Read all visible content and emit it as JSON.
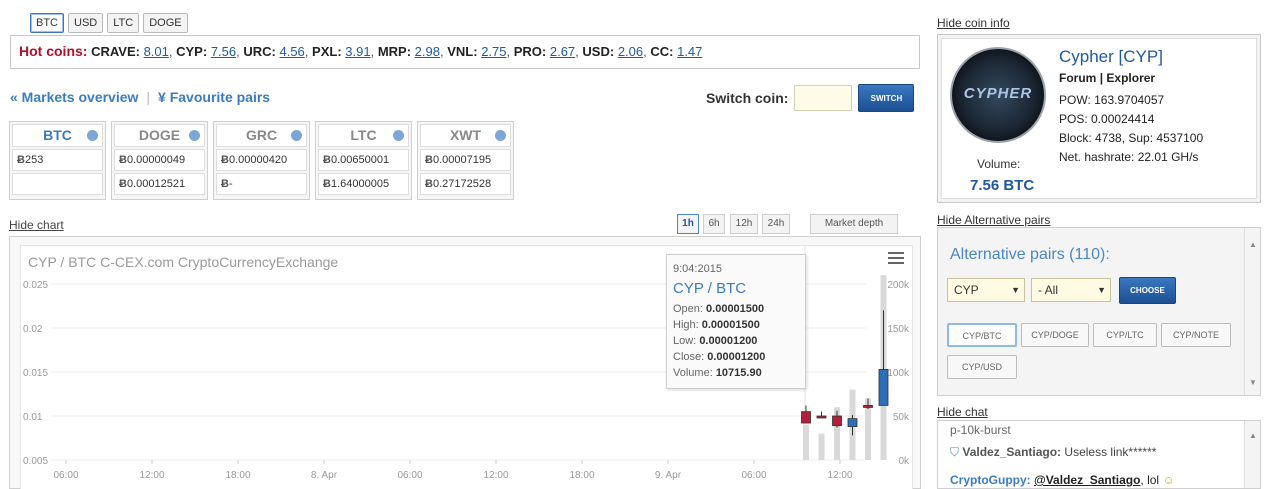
{
  "currency_tabs": [
    {
      "label": "BTC",
      "active": true
    },
    {
      "label": "USD",
      "active": false
    },
    {
      "label": "LTC",
      "active": false
    },
    {
      "label": "DOGE",
      "active": false
    }
  ],
  "hot_coins": {
    "label": "Hot coins:",
    "items": [
      {
        "name": "CRAVE:",
        "value": "8.01"
      },
      {
        "name": "CYP:",
        "value": "7.56"
      },
      {
        "name": "URC:",
        "value": "4.56"
      },
      {
        "name": "PXL:",
        "value": "3.91"
      },
      {
        "name": "MRP:",
        "value": "2.98"
      },
      {
        "name": "VNL:",
        "value": "2.75"
      },
      {
        "name": "PRO:",
        "value": "2.67"
      },
      {
        "name": "USD:",
        "value": "2.06"
      },
      {
        "name": "CC:",
        "value": "1.47"
      }
    ]
  },
  "nav": {
    "markets_overview": "« Markets overview",
    "separator": "|",
    "favourite_pairs": "¥ Favourite pairs"
  },
  "switch_coin": {
    "label": "Switch coin:",
    "input_value": "",
    "button": "SWITCH"
  },
  "coin_cards": [
    {
      "name": "BTC",
      "active": true,
      "row1": "253",
      "row2": ""
    },
    {
      "name": "DOGE",
      "active": false,
      "row1": "0.00000049",
      "row2": "0.00012521"
    },
    {
      "name": "GRC",
      "active": false,
      "row1": "0.00000420",
      "row2": "-"
    },
    {
      "name": "LTC",
      "active": false,
      "row1": "0.00650001",
      "row2": "1.64000005"
    },
    {
      "name": "XWT",
      "active": false,
      "row1": "0.00007195",
      "row2": "0.27172528"
    }
  ],
  "chart_controls": {
    "hide_chart": "Hide chart",
    "timeframes": [
      {
        "label": "1h",
        "active": true
      },
      {
        "label": "6h",
        "active": false
      },
      {
        "label": "12h",
        "active": false
      },
      {
        "label": "24h",
        "active": false
      }
    ],
    "market_depth": "Market depth"
  },
  "chart_data": {
    "type": "candlestick",
    "title": "CYP / BTC C-CEX.com CryptoCurrencyExchange",
    "y_ticks": [
      "0.025",
      "0.02",
      "0.015",
      "0.01",
      "0.005"
    ],
    "y2_ticks": [
      "200k",
      "150k",
      "100k",
      "50k",
      "0k"
    ],
    "x_ticks": [
      "06:00",
      "12:00",
      "18:00",
      "8. Apr",
      "06:00",
      "12:00",
      "18:00",
      "9. Apr",
      "06:00",
      "12:00"
    ],
    "ylim": [
      0.005,
      0.025
    ],
    "y2lim": [
      0,
      200000
    ],
    "candles": [
      {
        "t": 0,
        "open": 0.0105,
        "high": 0.0112,
        "low": 0.0095,
        "close": 0.0092,
        "volume": 40000
      },
      {
        "t": 1,
        "open": 0.01,
        "high": 0.0105,
        "low": 0.0098,
        "close": 0.0099,
        "volume": 30000
      },
      {
        "t": 2,
        "open": 0.01,
        "high": 0.0106,
        "low": 0.0087,
        "close": 0.0089,
        "volume": 60000
      },
      {
        "t": 3,
        "open": 0.0088,
        "high": 0.0101,
        "low": 0.0078,
        "close": 0.0097,
        "volume": 80000
      },
      {
        "t": 4,
        "open": 0.0112,
        "high": 0.012,
        "low": 0.0108,
        "close": 0.0111,
        "volume": 70000
      },
      {
        "t": 5,
        "open": 0.0112,
        "high": 0.022,
        "low": 0.0112,
        "close": 0.0153,
        "volume": 210000
      }
    ],
    "tooltip": {
      "date": "9:04:2015",
      "pair": "CYP / BTC",
      "open_label": "Open:",
      "open": "0.00001500",
      "high_label": "High:",
      "high": "0.00001500",
      "low_label": "Low:",
      "low": "0.00001200",
      "close_label": "Close:",
      "close": "0.00001200",
      "volume_label": "Volume:",
      "volume": "10715.90"
    }
  },
  "coin_info": {
    "hide_label": "Hide coin info",
    "logo_text": "CYPHER",
    "name": "Cypher [CYP]",
    "forum": "Forum",
    "sep": "|",
    "explorer": "Explorer",
    "pow": "POW: 163.9704057",
    "pos": "POS: 0.00024414",
    "block": "Block: 4738, Sup: 4537100",
    "hashrate": "Net. hashrate: 22.01 GH/s",
    "volume_label": "Volume:",
    "volume_value": "7.56 BTC"
  },
  "alt_pairs": {
    "hide_label": "Hide Alternative pairs",
    "title": "Alternative pairs (110):",
    "select1": "CYP",
    "select2": "- All",
    "choose_button": "CHOOSE",
    "pairs": [
      "CYP/BTC",
      "CYP/DOGE",
      "CYP/LTC",
      "CYP/NOTE",
      "CYP/USD"
    ]
  },
  "chat": {
    "hide_label": "Hide chat",
    "line0": "p-10k-burst",
    "line1_user": "Valdez_Santiago:",
    "line1_text": "Useless link******",
    "line2_user": "CryptoGuppy:",
    "line2_mention": "@Valdez_Santiago",
    "line2_text": ", lol"
  },
  "colors": {
    "accent": "#3a7cc2",
    "hot_label": "#b0102c",
    "candle_down": "#b21f3a",
    "candle_up": "#2c6fb8"
  }
}
